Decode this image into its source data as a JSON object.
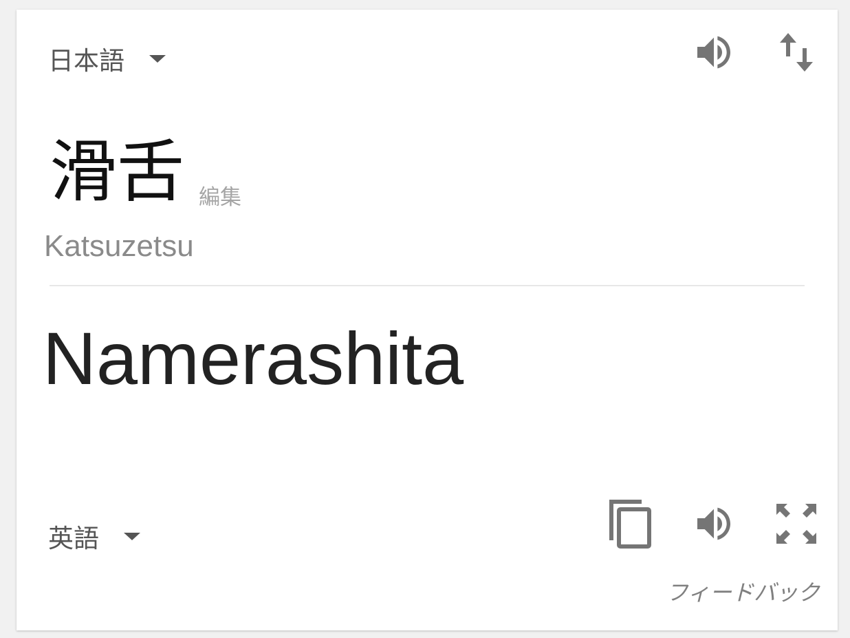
{
  "source": {
    "language": "日本語",
    "text": "滑舌",
    "edit_label": "編集",
    "romanization": "Katsuzetsu"
  },
  "target": {
    "language": "英語",
    "text": "Namerashita"
  },
  "feedback_label": "フィードバック",
  "icons": {
    "source_speaker": "speaker-icon",
    "swap": "swap-languages-icon",
    "copy": "copy-icon",
    "target_speaker": "speaker-icon",
    "expand": "fullscreen-icon"
  },
  "colors": {
    "icon": "#757575",
    "text_primary": "#222222",
    "text_muted": "#8a8a8a"
  }
}
